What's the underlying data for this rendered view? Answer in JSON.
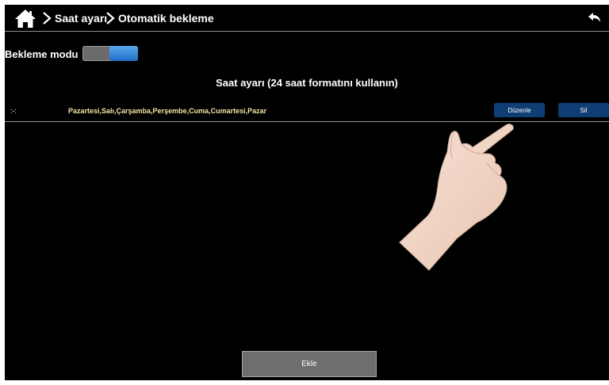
{
  "breadcrumb": {
    "item1": "Saat ayarı",
    "item2": "Otomatik bekleme"
  },
  "mode": {
    "label": "Bekleme modu",
    "enabled": true
  },
  "section_title": "Saat ayarı (24 saat formatını kullanın)",
  "schedule": [
    {
      "time": ":-:",
      "days": "Pazartesi,Salı,Çarşamba,Perşembe,Cuma,Cumartesi,Pazar",
      "edit_label": "Düzenle",
      "delete_label": "Sil"
    }
  ],
  "add_button_label": "Ekle",
  "icons": [
    "home-icon",
    "chevron-right-icon",
    "back-arrow-icon",
    "pointing-hand-icon"
  ],
  "colors": {
    "background": "#000000",
    "accent_blue": "#1e6fc7",
    "button_blue": "#0f3e74",
    "days_text": "#f2e6a6"
  }
}
